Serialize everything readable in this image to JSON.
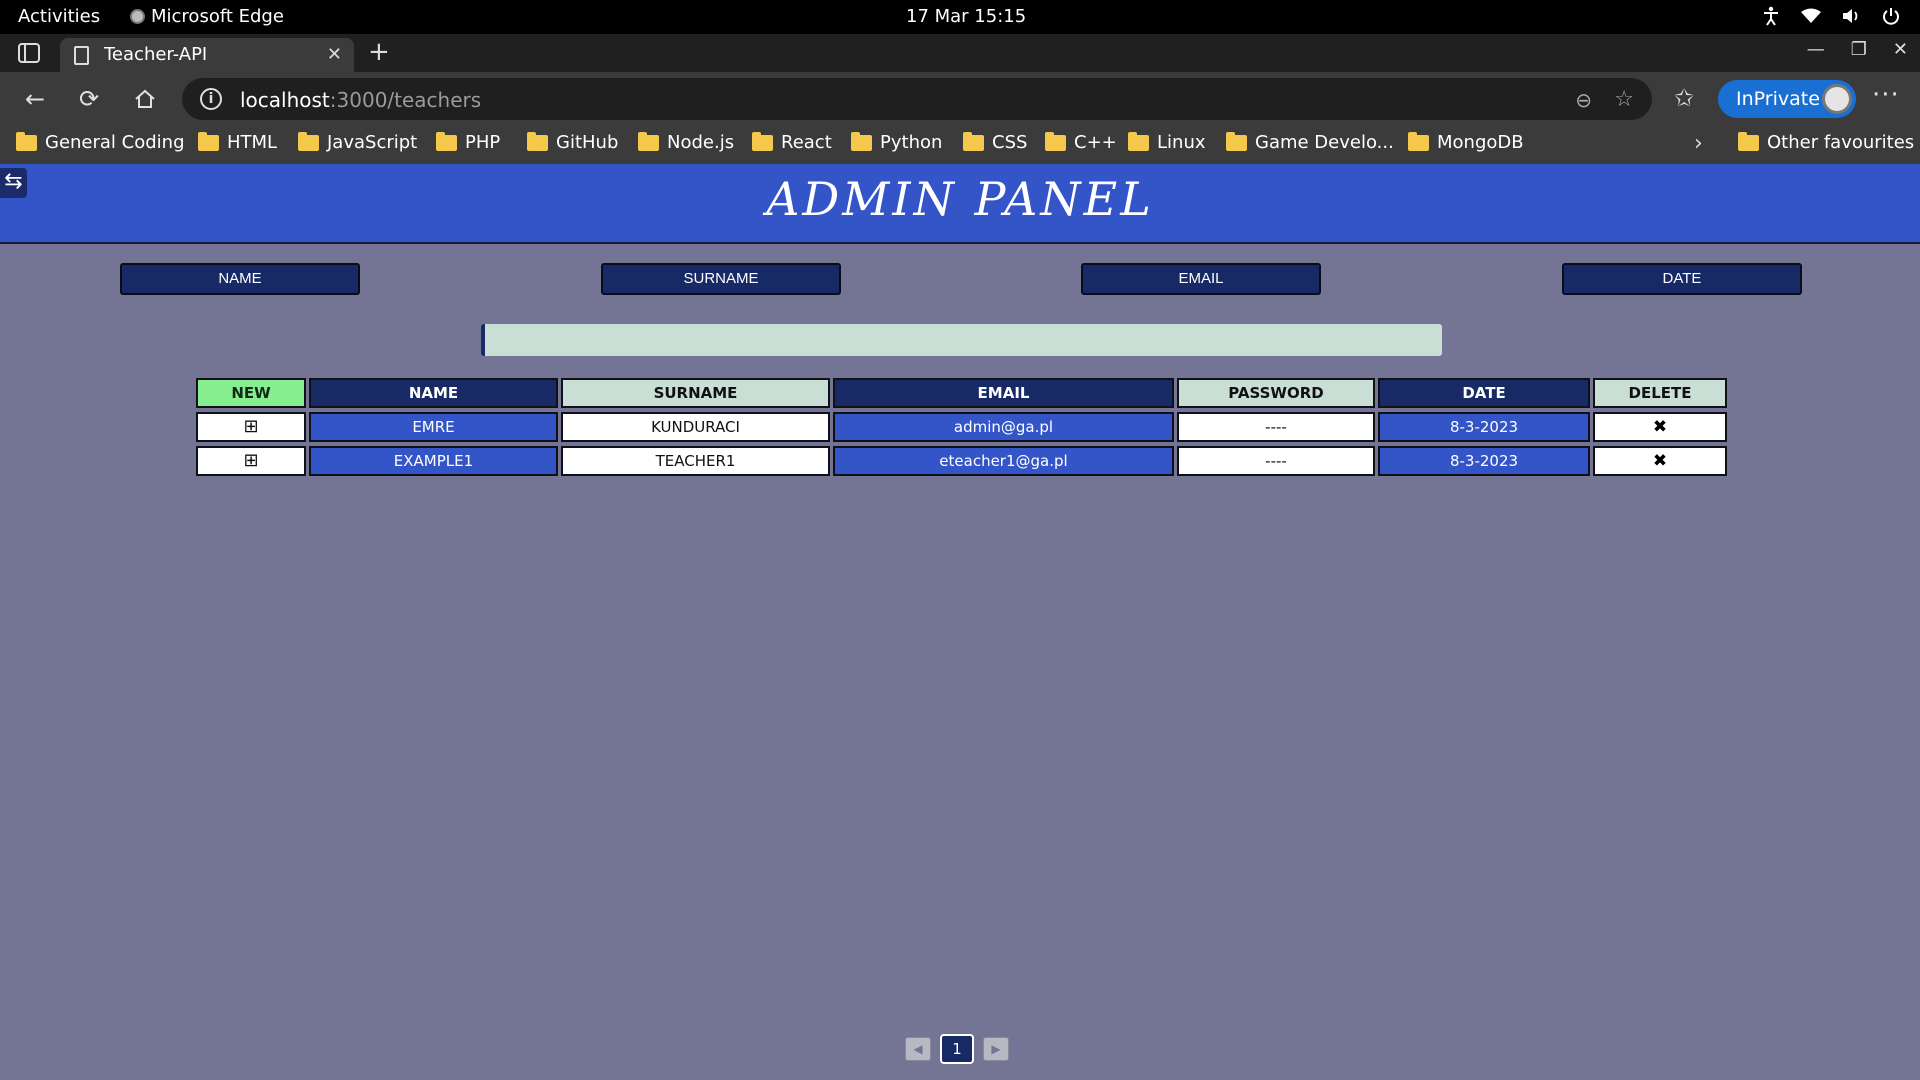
{
  "system": {
    "activities": "Activities",
    "app_name": "Microsoft Edge",
    "clock": "17 Mar  15:15"
  },
  "browser": {
    "tab_title": "Teacher-API",
    "url_host": "localhost",
    "url_rest": ":3000/teachers",
    "inprivate_label": "InPrivate",
    "bookmarks": [
      "General Coding",
      "HTML",
      "JavaScript",
      "PHP",
      "GitHub",
      "Node.js",
      "React",
      "Python",
      "CSS",
      "C++",
      "Linux",
      "Game Develo...",
      "MongoDB"
    ],
    "other_favourites": "Other favourites"
  },
  "admin": {
    "title": "ADMIN PANEL",
    "sidebar_toggle": "⇆",
    "filter_buttons": [
      "NAME",
      "SURNAME",
      "EMAIL",
      "DATE"
    ],
    "search_value": "",
    "table": {
      "headers": [
        "NEW",
        "NAME",
        "SURNAME",
        "EMAIL",
        "PASSWORD",
        "DATE",
        "DELETE"
      ],
      "rows": [
        {
          "new": "⊞",
          "name": "EMRE",
          "surname": "KUNDURACI",
          "email": "admin@ga.pl",
          "password": "----",
          "date": "8-3-2023",
          "delete": "✖"
        },
        {
          "new": "⊞",
          "name": "EXAMPLE1",
          "surname": "TEACHER1",
          "email": "eteacher1@ga.pl",
          "password": "----",
          "date": "8-3-2023",
          "delete": "✖"
        }
      ]
    },
    "pagination": {
      "prev": "◀",
      "current_page": "1",
      "next": "▶"
    }
  },
  "colors": {
    "page_bg": "#747495",
    "header_blue": "#3355c8",
    "navy": "#172a66",
    "mint": "#c9dfd6",
    "new_green": "#86ee8e"
  }
}
